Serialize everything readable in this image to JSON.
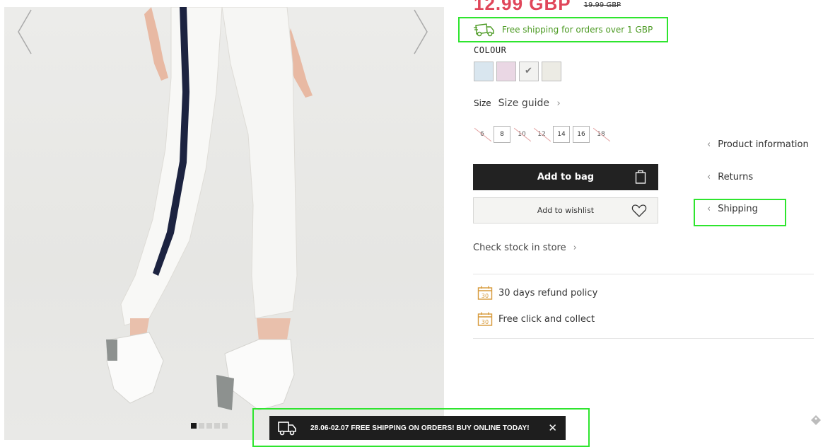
{
  "product": {
    "price": "12.99 GBP",
    "old_price": "19.99 GBP"
  },
  "promo_shipping": "Free shipping for orders over 1 GBP",
  "colour": {
    "label": "COLOUR",
    "swatches": [
      {
        "name": "light blue",
        "color": "#d9e6ef",
        "selected": false
      },
      {
        "name": "light pink",
        "color": "#ead7e4",
        "selected": false
      },
      {
        "name": "white",
        "color": "#f2f2f0",
        "selected": true
      },
      {
        "name": "beige",
        "color": "#ecebe4",
        "selected": false
      }
    ]
  },
  "size": {
    "label": "Size",
    "guide": "Size guide",
    "options": [
      {
        "label": "6",
        "available": false
      },
      {
        "label": "8",
        "available": true
      },
      {
        "label": "10",
        "available": false
      },
      {
        "label": "12",
        "available": false
      },
      {
        "label": "14",
        "available": true
      },
      {
        "label": "16",
        "available": true
      },
      {
        "label": "18",
        "available": false
      }
    ]
  },
  "buttons": {
    "add_to_bag": "Add to bag",
    "add_to_wishlist": "Add to wishlist"
  },
  "check_stock": "Check stock in store",
  "perks": [
    {
      "icon": "calendar-30-icon",
      "text": "30 days refund policy"
    },
    {
      "icon": "calendar-30-icon",
      "text": "Free click and collect"
    }
  ],
  "info_links": [
    "Product information",
    "Returns",
    "Shipping"
  ],
  "promo_bar": {
    "text": "28.06-02.07 FREE SHIPPING ON ORDERS! BUY ONLINE TODAY!",
    "close": "✕"
  },
  "gallery": {
    "slide_count": 5,
    "active_slide": 1
  },
  "colors": {
    "price_red": "#e0465a",
    "promo_green": "#4c9a23",
    "dark": "#222222",
    "highlight": "#2ee52e"
  }
}
